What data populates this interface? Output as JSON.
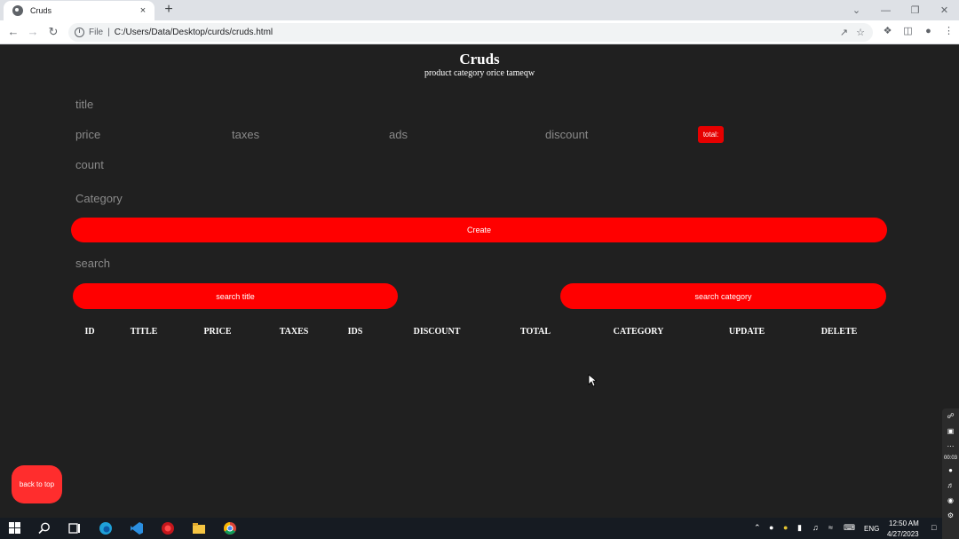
{
  "browser": {
    "tab_title": "Cruds",
    "tab_close": "×",
    "new_tab": "+",
    "url_protocol": "File",
    "url_separator": "|",
    "url": "C:/Users/Data/Desktop/curds/cruds.html",
    "window_controls": [
      "⌄",
      "—",
      "❐",
      "✕"
    ]
  },
  "header": {
    "title": "Cruds",
    "subtitle": "product category orice tameqw"
  },
  "form": {
    "title_placeholder": "title",
    "price_placeholder": "price",
    "taxes_placeholder": "taxes",
    "ads_placeholder": "ads",
    "discount_placeholder": "discount",
    "total_label": "total:",
    "count_placeholder": "count",
    "category_placeholder": "Category",
    "create_label": "Create"
  },
  "search": {
    "placeholder": "search",
    "by_title_label": "search title",
    "by_category_label": "search category"
  },
  "table": {
    "columns": [
      "ID",
      "TITLE",
      "PRICE",
      "TAXES",
      "IDS",
      "DISCOUNT",
      "TOTAL",
      "CATEGORY",
      "UPDATE",
      "DELETE"
    ]
  },
  "back_to_top_label": "back to top",
  "taskbar": {
    "language": "ENG",
    "time": "12:50 AM",
    "date": "4/27/2023"
  },
  "recorder": {
    "timer": "00:03"
  }
}
